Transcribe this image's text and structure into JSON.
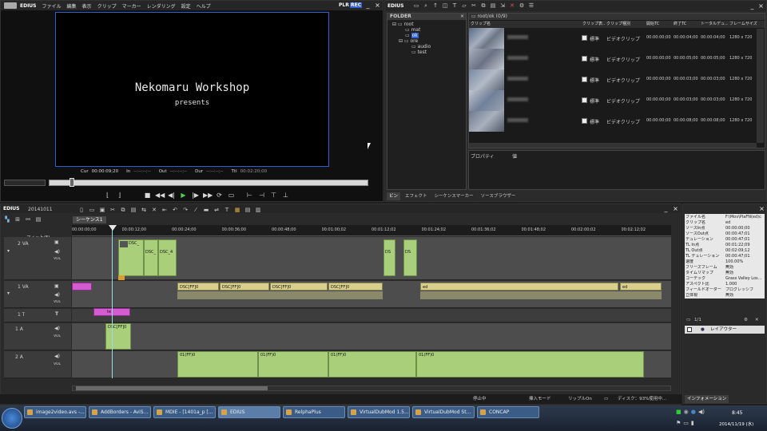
{
  "player": {
    "logo": "EDIUS",
    "menu": [
      "ファイル",
      "編集",
      "表示",
      "クリップ",
      "マーカー",
      "レンダリング",
      "設定",
      "ヘルプ"
    ],
    "mode_plr": "PLR",
    "mode_rec": "REC",
    "preview_title": "Nekomaru Workshop",
    "preview_subtitle": "presents",
    "tc_cur_label": "Cur",
    "tc_cur": "00:00:09;20",
    "tc_in_label": "In",
    "tc_in": "--:--:--;--",
    "tc_out_label": "Out",
    "tc_out": "--:--:--;--",
    "tc_dur_label": "Dur",
    "tc_dur": "--:--:--;--",
    "tc_ttl_label": "Ttl",
    "tc_ttl": "00:02:20;00"
  },
  "bin": {
    "logo": "EDIUS",
    "folder_header": "FOLDER",
    "tree": [
      "root",
      "mat",
      "ok",
      "ore",
      "audio",
      "test"
    ],
    "path": "root/ok (0/9)",
    "columns": [
      "クリップ名",
      "クリップ表...",
      "クリップ種別",
      "開始TC",
      "終了TC",
      "トータルデュ...",
      "フレームサイズ"
    ],
    "rows": [
      {
        "flag": "標準",
        "type": "ビデオクリップ",
        "start": "00:00:00;00",
        "end": "00:00:04;00",
        "total": "00:00:04;00",
        "size": "1280 x 720"
      },
      {
        "flag": "標準",
        "type": "ビデオクリップ",
        "start": "00:00:00;00",
        "end": "00:00:05;00",
        "total": "00:00:05;00",
        "size": "1280 x 720"
      },
      {
        "flag": "標準",
        "type": "ビデオクリップ",
        "start": "00:00:00;00",
        "end": "00:00:03;00",
        "total": "00:00:03;00",
        "size": "1280 x 720"
      },
      {
        "flag": "標準",
        "type": "ビデオクリップ",
        "start": "00:00:00;00",
        "end": "00:00:03;00",
        "total": "00:00:03;00",
        "size": "1280 x 720"
      },
      {
        "flag": "標準",
        "type": "ビデオクリップ",
        "start": "00:00:00;00",
        "end": "00:00:08;00",
        "total": "00:00:08;00",
        "size": "1280 x 720"
      }
    ],
    "prop_label": "プロパティ",
    "prop_value": "値",
    "tabs": [
      "ビン",
      "エフェクト",
      "シーケンスマーカー",
      "ソースブラウザー"
    ]
  },
  "timeline": {
    "logo": "EDIUS",
    "project": "20141011",
    "sequence_tab": "シーケンス1",
    "fit": "フィット(F)",
    "ruler": [
      "00:00:00;00",
      "00:00:12;00",
      "00:00:24;00",
      "00:00:36;00",
      "00:00:48;00",
      "00:01:00;02",
      "00:01:12;02",
      "00:01:24;02",
      "00:01:36;02",
      "00:01:48;02",
      "00:02:00;02",
      "00:02:12;02"
    ],
    "tracks": [
      "2 VA",
      "1 VA",
      "1 T",
      "1 A",
      "2 A"
    ],
    "vol": "VOL",
    "clip_labels": {
      "va2_a": "DSC_",
      "va2_b": "DSC_",
      "va2_c": "DSC_4",
      "va2_d": "DS",
      "va2_e": "DS",
      "va1_a": "DSC[FF]0",
      "va1_b": "DSC[FF]0",
      "va1_c": "DSC[FF]0",
      "va1_d": "DSC[FF]0",
      "va1_e": "ed",
      "va1_f": "ed",
      "t1": "te",
      "a1": "DSC[FF]0",
      "a2_a": "01(FF)0",
      "a2_b": "01(FF)0",
      "a2_c": "01(FF)0",
      "a2_d": "01(FF)0"
    },
    "status": [
      "停止中",
      "挿入モード",
      "リップルOn",
      "ディスク：93%使用中..."
    ]
  },
  "info": {
    "rows": [
      [
        "ファイル名",
        "F:\\Mov\\PlaFN(ed)c"
      ],
      [
        "クリップ名",
        "ed"
      ],
      [
        "ソースIn点",
        "00:00:00;00"
      ],
      [
        "ソースOut点",
        "00:00:47;01"
      ],
      [
        "デュレーション",
        "00:00:47;01"
      ],
      [
        "TL In点",
        "00:01:22;09"
      ],
      [
        "TL Out点",
        "00:02:09;12"
      ],
      [
        "TL デュレーション",
        "00:00:47;01"
      ],
      [
        "速度",
        "100.00%"
      ],
      [
        "フリーズフレーム",
        "無効"
      ],
      [
        "タイムリマップ",
        "無効"
      ],
      [
        "コーデック",
        "Grass Valley Los..."
      ],
      [
        "アスペクト比",
        "1.000"
      ],
      [
        "フィールドオーダー",
        "プログレッシブ"
      ],
      [
        "立体視",
        "無効"
      ]
    ],
    "page": "1/1",
    "layer": "レイアウター",
    "tab": "インフォメーション"
  },
  "taskbar": {
    "items": [
      "image2video.avs -...",
      "AddBorders - AviS...",
      "MDIE - [1401a_p [...",
      "EDIUS",
      "RelphaPlus",
      "VirtualDubMod 1.5...",
      "VirtualDubMod St...",
      "CONCAP"
    ],
    "time": "8:45",
    "date": "2014/11/19 (水)"
  },
  "colors": {
    "accent_blue": "#2f5fd0",
    "clip_green": "#9dc76a",
    "clip_yellow": "#d8cf8c",
    "clip_pink": "#d55bd2",
    "playhead": "#9dd8e8"
  }
}
